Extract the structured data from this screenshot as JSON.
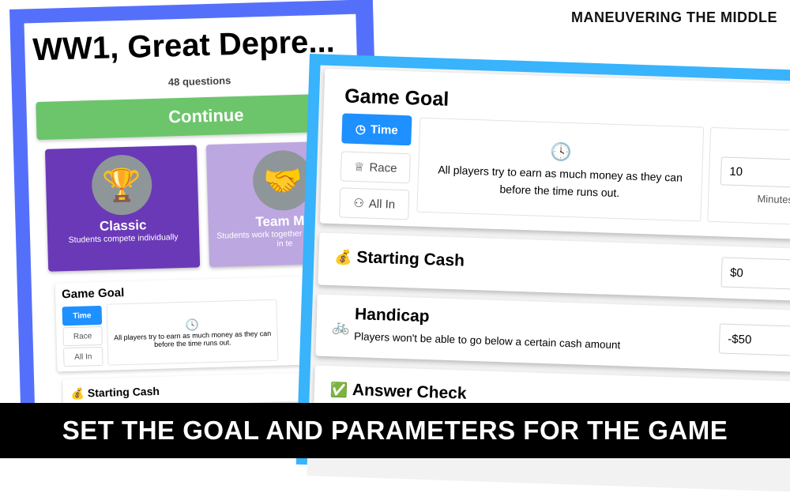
{
  "brand": "MANEUVERING THE MIDDLE",
  "banner": "SET THE GOAL AND PARAMETERS FOR THE GAME",
  "left": {
    "title": "WW1, Great Depre...",
    "subtitle": "48 questions",
    "continue_label": "Continue",
    "modes": [
      {
        "name": "Classic",
        "desc": "Students compete individually",
        "icon": "trophy-icon"
      },
      {
        "name": "Team Mo",
        "desc": "Students work together and compete in te",
        "icon": "hands-icon"
      }
    ],
    "game_goal": {
      "title": "Game Goal",
      "buttons": [
        "Time",
        "Race",
        "All In"
      ],
      "desc": "All players try to earn as much money as they can before the time runs out."
    },
    "starting_cash": "Starting Cash"
  },
  "right": {
    "game_goal": {
      "title": "Game Goal",
      "buttons": [
        {
          "label": "Time",
          "icon": "clock-icon",
          "active": true
        },
        {
          "label": "Race",
          "icon": "trophy-icon",
          "active": false
        },
        {
          "label": "All In",
          "icon": "users-icon",
          "active": false
        }
      ],
      "desc": "All players try to earn as much money as they can before the time runs out.",
      "time_value": "10",
      "time_unit": "Minutes"
    },
    "starting_cash": {
      "title": "Starting Cash",
      "icon": "💰",
      "value": "$0"
    },
    "handicap": {
      "title": "Handicap",
      "icon": "🚲",
      "desc": "Players won't be able to go below a certain cash amount",
      "value": "-$50"
    },
    "answer_check": {
      "title": "Answer Check",
      "icon": "✅"
    }
  },
  "colors": {
    "left_frame": "#5470fb",
    "right_frame": "#38b3fc",
    "continue": "#6cc56a",
    "active_tab": "#1e90ff",
    "classic": "#6a39b7",
    "team": "#bda7e0"
  }
}
